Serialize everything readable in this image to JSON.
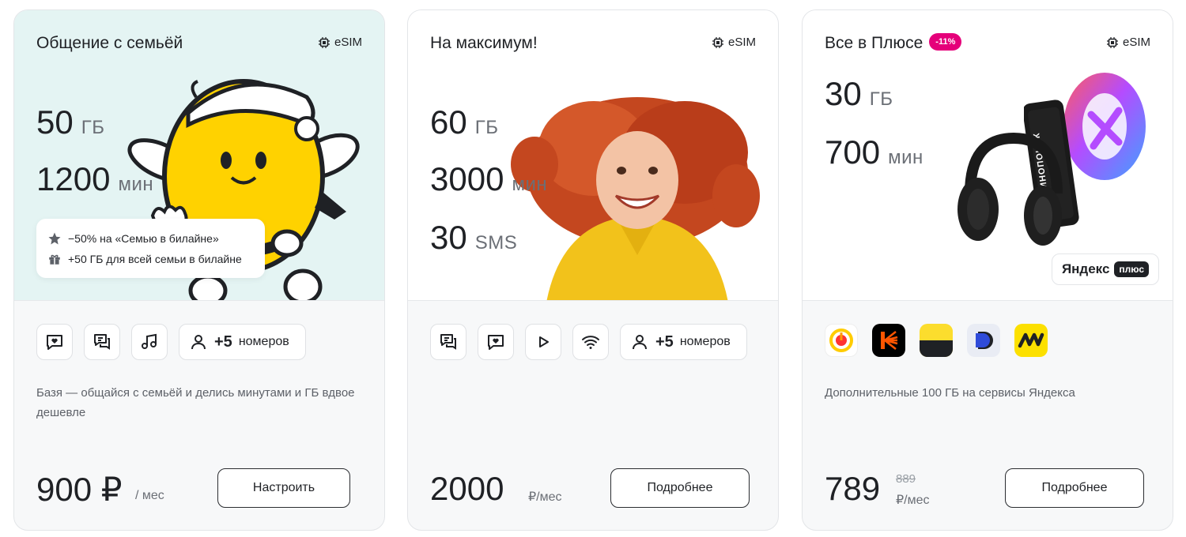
{
  "cards": [
    {
      "title": "Общение с семьёй",
      "esim": "eSIM",
      "gb_value": "50",
      "gb_unit": "ГБ",
      "min_value": "1200",
      "min_unit": "мин",
      "promo": [
        {
          "icon": "star-icon",
          "text": "−50% на «Семью в билайне»"
        },
        {
          "icon": "gift-icon",
          "text": "+50 ГБ для всей семьи в билайне"
        }
      ],
      "feature_icons": [
        "chat-heart-icon",
        "chat-icon",
        "music-icon"
      ],
      "numbers_count": "+5",
      "numbers_label": "номеров",
      "description": "Базя — общайся с семьёй и делись минутами и ГБ вдвое дешевле",
      "price": "900 ₽",
      "per": "/ мес",
      "button": "Настроить",
      "illustration": "bee-mascot"
    },
    {
      "title": "На максимум!",
      "esim": "eSIM",
      "gb_value": "60",
      "gb_unit": "ГБ",
      "min_value": "3000",
      "min_unit": "мин",
      "sms_value": "30",
      "sms_unit": "SMS",
      "feature_icons": [
        "chat-icon",
        "chat-heart-icon",
        "play-icon",
        "wifi-icon"
      ],
      "numbers_count": "+5",
      "numbers_label": "номеров",
      "price": "2000",
      "per": "₽/мес",
      "button": "Подробнее",
      "illustration": "smiling-woman-yellow-shirt"
    },
    {
      "title": "Все в Плюсе",
      "badge": "-11%",
      "esim": "eSIM",
      "gb_value": "30",
      "gb_unit": "ГБ",
      "min_value": "700",
      "min_unit": "мин",
      "logo_text": "Яндекс",
      "logo_badge": "плюс",
      "phone_text": "КИНОПОИСК",
      "app_icons": [
        "yandex-music-icon",
        "kinopoisk-icon",
        "yandex-go-icon",
        "yandex-disk-icon",
        "yandex-market-icon"
      ],
      "description": "Дополнительные 100 ГБ на сервисы Яндекса",
      "price": "789",
      "old_price": "889",
      "per": "₽/мес",
      "button": "Подробнее",
      "illustration": "headphones-phone-plus-logo"
    }
  ],
  "colors": {
    "accent_yellow": "#FFD200",
    "badge_pink": "#E5007A",
    "mint": "#E4F4F3"
  }
}
